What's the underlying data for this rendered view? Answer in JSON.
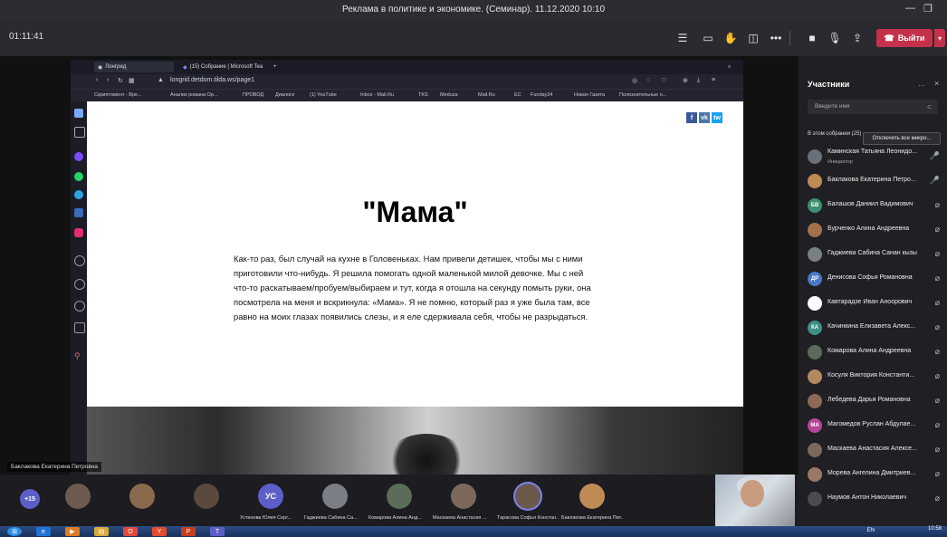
{
  "window": {
    "title": "Реклама в политике и экономике. (Семинар). 11.12.2020 10:10",
    "minimize_icon": "minimize-icon",
    "maximize_icon": "maximize-icon"
  },
  "toolbar": {
    "timer": "01:11:41",
    "leave_label": "Выйти",
    "icons": [
      "participants-icon",
      "chat-icon",
      "raise-hand-icon",
      "rooms-icon",
      "more-icon",
      "camera-icon",
      "mic-icon",
      "share-icon"
    ]
  },
  "browser": {
    "tabs": [
      "Лонгрид",
      "(15) Собрание | Microsoft Tea"
    ],
    "new_tab": "+",
    "address": "longrid.detdom.tilda.ws/page1",
    "bookmarks": [
      "Скриптомент - Вре...",
      "Анализ романа Ор...",
      "ПРОВОД",
      "Диалоги",
      "(1) YouTube",
      "Inbox - Mail.Ru",
      "TKS",
      "Meduza",
      "Mail.Ru",
      "EC",
      "Funday24",
      "Новая Газета",
      "Полезнительные н..."
    ]
  },
  "page": {
    "share": [
      "f",
      "vk",
      "tw"
    ],
    "heading": "\"Мама\"",
    "text": "Как-то раз, был случай на кухне в Головеньках. Нам привели детишек, чтобы мы с ними приготовили что-нибудь. Я решила помогать одной маленькой милой девочке. Мы с ней что-то раскатываем/пробуем/выбираем и тут, когда я отошла на секунду помыть руки, она посмотрела на меня и вскрикнула: «Мама». Я не помню, который раз я уже была там, все равно на моих глазах появились слезы, и я еле сдерживала себя, чтобы не разрыдаться."
  },
  "panel": {
    "title": "Участники",
    "search_placeholder": "Введите имя",
    "in_meeting": "В этом собрании (25)",
    "mute_all": "Отключить все микро...",
    "participants": [
      {
        "name": "Каминская Татьяна Леонидо...",
        "role": "Инициатор",
        "initials": "",
        "color": "#6a6f78"
      },
      {
        "name": "Баклакова Екатерина Петро...",
        "role": "",
        "initials": "",
        "color": "#c08a55"
      },
      {
        "name": "Балашов Даниил Вадимович",
        "role": "",
        "initials": "БВ",
        "color": "#3d8f6e"
      },
      {
        "name": "Бурченко Алина Андреевна",
        "role": "",
        "initials": "",
        "color": "#a0724a"
      },
      {
        "name": "Гаджиева Сабина Санан кызы",
        "role": "",
        "initials": "",
        "color": "#7a7f86"
      },
      {
        "name": "Денисова Софья Романовна",
        "role": "",
        "initials": "ДР",
        "color": "#4a78c2"
      },
      {
        "name": "Кавтарадзе Иван Аноорович",
        "role": "",
        "initials": "",
        "color": "#ffffff"
      },
      {
        "name": "Качинкина Елизавета Алекс...",
        "role": "",
        "initials": "КА",
        "color": "#3d8f8a"
      },
      {
        "name": "Комарова Алина Андреевна",
        "role": "",
        "initials": "",
        "color": "#5b6c5a"
      },
      {
        "name": "Косуля Виктория Константи...",
        "role": "",
        "initials": "",
        "color": "#b38a60"
      },
      {
        "name": "Лебедева Дарья Романовна",
        "role": "",
        "initials": "",
        "color": "#8c6a55"
      },
      {
        "name": "Магомедов Руслан Абдулае...",
        "role": "",
        "initials": "МА",
        "color": "#b4469a"
      },
      {
        "name": "Маскаева Анастасия Алексе...",
        "role": "",
        "initials": "",
        "color": "#7b6a5b"
      },
      {
        "name": "Морева Ангелина Дмитриев...",
        "role": "",
        "initials": "",
        "color": "#9a7868"
      },
      {
        "name": "Наумов Антон Николаевич",
        "role": "",
        "initials": "",
        "color": "#4b4b52"
      }
    ]
  },
  "speaker_label": "Баклакова Екатерина Петровна",
  "strip": {
    "more": "+15",
    "tiles": [
      {
        "label": "",
        "initials": "",
        "color": "#6c5b4e"
      },
      {
        "label": "",
        "initials": "",
        "color": "#8a6a4c"
      },
      {
        "label": "",
        "initials": "",
        "color": "#5a4a3e"
      },
      {
        "label": "Устинова Юлия Серг...",
        "initials": "УС",
        "color": "#5b5fc7"
      },
      {
        "label": "Гаджиева Сабина Са...",
        "initials": "",
        "color": "#7a7f86"
      },
      {
        "label": "Комарова Алина Анд...",
        "initials": "",
        "color": "#5b6c5a"
      },
      {
        "label": "Маскаева Анастасия ...",
        "initials": "",
        "color": "#7b6a5b"
      },
      {
        "label": "Тарасова Софья Констан...",
        "initials": "",
        "color": "#6b5a4c"
      },
      {
        "label": "Баклакова Екатерина Пет...",
        "initials": "",
        "color": "#c08a55"
      }
    ]
  },
  "taskbar": {
    "lang": "EN",
    "clock": "10:58"
  }
}
